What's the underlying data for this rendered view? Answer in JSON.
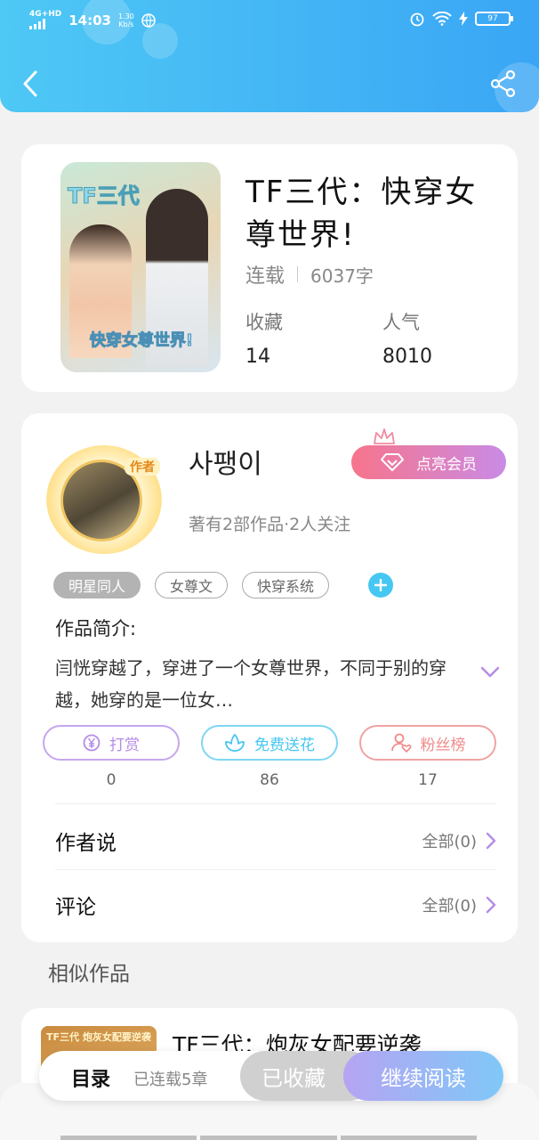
{
  "status_bar": {
    "network": "4G+HD",
    "time": "14:03",
    "speed_value": "1.30",
    "speed_unit": "Kb/s",
    "battery": "97"
  },
  "header": {
    "back_icon": "chevron-left-icon",
    "share_icon": "share-icon"
  },
  "book": {
    "cover_text_top": "TF三代",
    "cover_text_bottom": "快穿女尊世界!",
    "title": "TF三代：快穿女尊世界!",
    "status": "连载",
    "word_count": "6037字",
    "favorites_label": "收藏",
    "favorites_value": "14",
    "popularity_label": "人气",
    "popularity_value": "8010"
  },
  "author": {
    "name": "사팽이",
    "badge": "作者",
    "subtitle": "著有2部作品·2人关注",
    "vip_button": "点亮会员",
    "tags": [
      "明星同人",
      "女尊文",
      "快穿系统"
    ],
    "intro_label": "作品简介:",
    "intro_text": "闫恍穿越了，穿进了一个女尊世界，不同于别的穿越，她穿的是一位女…",
    "actions": [
      {
        "label": "打赏",
        "count": "0",
        "icon": "yen-coin-icon"
      },
      {
        "label": "免费送花",
        "count": "86",
        "icon": "flower-icon"
      },
      {
        "label": "粉丝榜",
        "count": "17",
        "icon": "fans-heart-icon"
      }
    ],
    "author_says_label": "作者说",
    "author_says_all": "全部(0)",
    "comments_label": "评论",
    "comments_all": "全部(0)"
  },
  "similar": {
    "section_title": "相似作品",
    "items": [
      {
        "title": "TF三代：炮灰女配要逆袭",
        "thumb_text": "TF三代 炮灰女配要逆袭"
      }
    ]
  },
  "bottom_bar": {
    "toc_label": "目录",
    "toc_sub": "已连载5章",
    "collected": "已收藏",
    "continue": "继续阅读"
  },
  "colors": {
    "header_start": "#4ec8f5",
    "header_end": "#3aa6f5",
    "vip_start": "#f7748b",
    "vip_end": "#c98be6",
    "reward": "#b58be6",
    "flower": "#46c7f1",
    "fans": "#f08a8a"
  }
}
